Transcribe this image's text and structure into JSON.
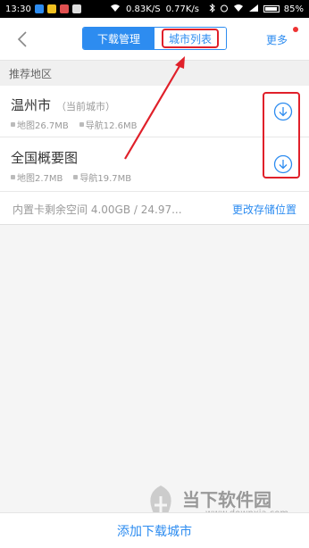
{
  "status_bar": {
    "time": "13:30",
    "net_down": "0.83K/S",
    "net_up": "0.77K/s",
    "battery": "85%"
  },
  "header": {
    "tab_download": "下载管理",
    "tab_city_list": "城市列表",
    "more": "更多"
  },
  "section": {
    "title": "推荐地区"
  },
  "items": [
    {
      "name": "温州市",
      "note": "（当前城市）",
      "map_size": "地图26.7MB",
      "nav_size": "导航12.6MB"
    },
    {
      "name": "全国概要图",
      "note": "",
      "map_size": "地图2.7MB",
      "nav_size": "导航19.7MB"
    }
  ],
  "storage": {
    "info": "内置卡剩余空间 4.00GB / 24.97...",
    "change": "更改存储位置"
  },
  "bottom": {
    "add_city": "添加下载城市"
  },
  "watermark": {
    "name": "当下软件园",
    "url": "www.downxia.com"
  },
  "colors": {
    "accent": "#2d8cf0",
    "annotation": "#e0202a"
  }
}
